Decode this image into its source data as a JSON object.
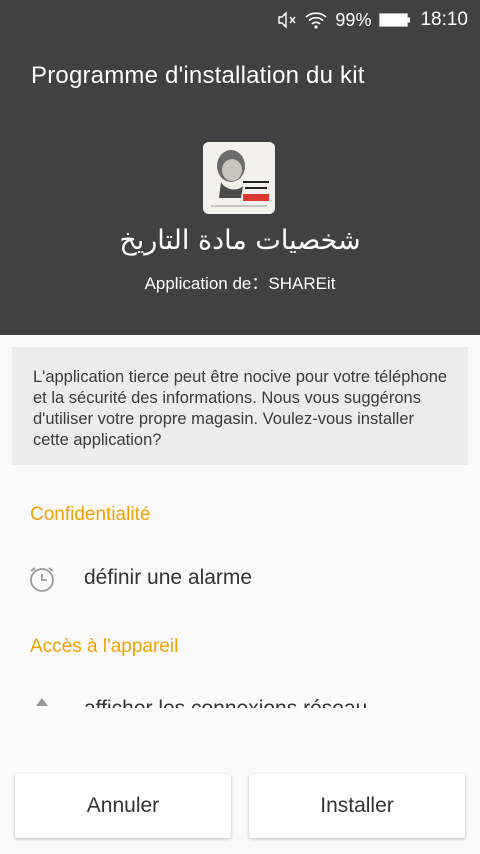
{
  "status_bar": {
    "icons": [
      "mute-icon",
      "wifi-icon",
      "battery-icon"
    ],
    "battery": "99%",
    "time": "18:10"
  },
  "header": {
    "title": "Programme d'installation du kit",
    "app_name": "شخصيات مادة التاريخ",
    "source": "Application de：SHAREit",
    "background": "#414141"
  },
  "warning": {
    "text": "L'application tierce peut être nocive pour votre téléphone et la sécurité des informations. Nous vous suggérons d'utiliser votre propre magasin. Voulez-vous installer cette application?"
  },
  "sections": {
    "privacy": {
      "title": "Confidentialité",
      "permission": "définir une alarme",
      "icon": "alarm-clock-icon"
    },
    "device": {
      "title": "Accès à l'appareil",
      "permission": "afficher les connexions réseau",
      "icon": "network-icon"
    }
  },
  "accent_color": "#f2a000",
  "buttons": {
    "cancel": "Annuler",
    "install": "Installer"
  }
}
